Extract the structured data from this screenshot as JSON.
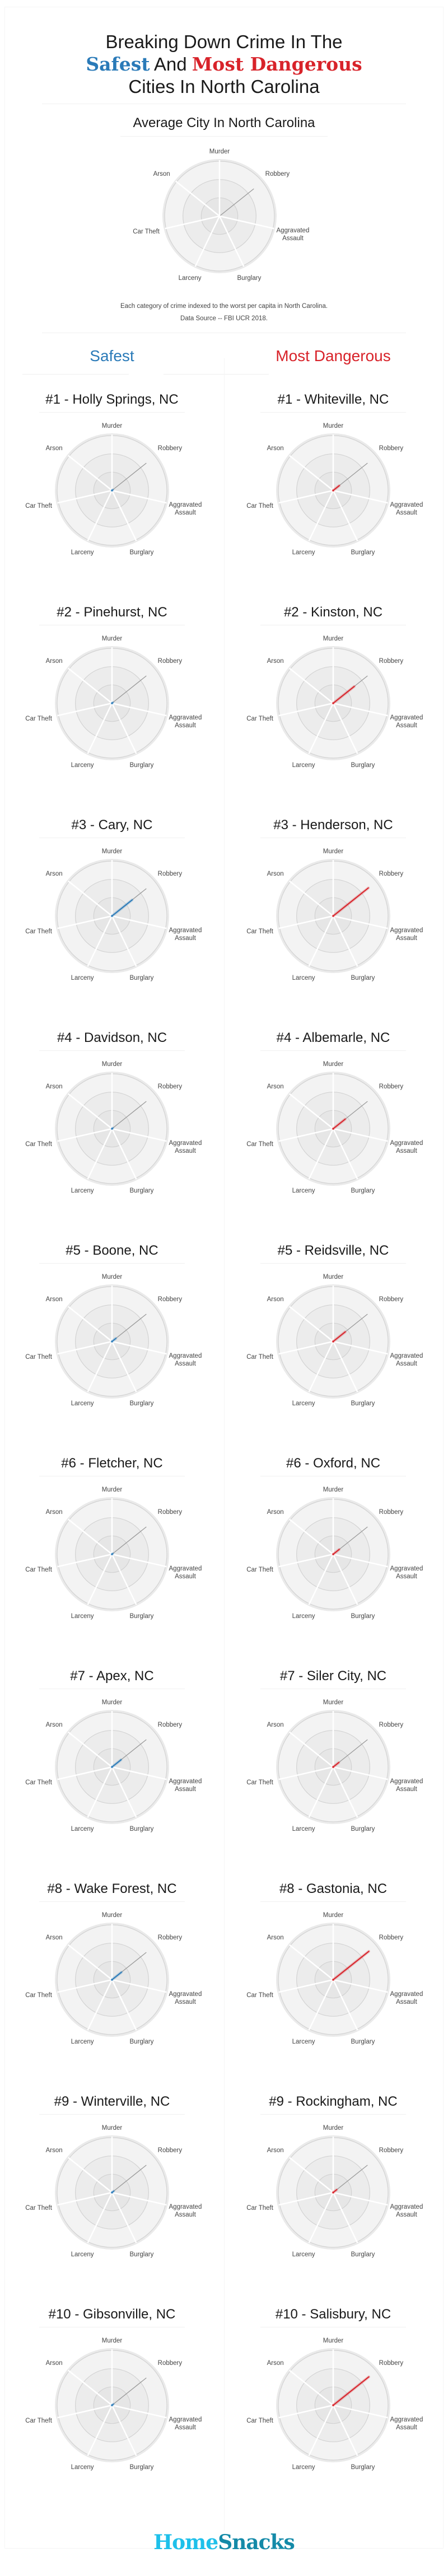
{
  "header": {
    "line1": "Breaking Down Crime In The",
    "safest": "Safest",
    "and": " And ",
    "most_dangerous": "Most Dangerous",
    "line3": "Cities In North Carolina"
  },
  "average": {
    "title": "Average City In North Carolina",
    "note_line1": "Each category of crime indexed to the worst per capita in North Carolina.",
    "note_line2": "Data Source -- FBI UCR 2018."
  },
  "columns": {
    "safest_label": "Safest",
    "dangerous_label": "Most Dangerous"
  },
  "colors": {
    "safest": "#2a7ab8",
    "dangerous": "#d8232a",
    "reference": "#9a9a9a"
  },
  "footer": {
    "logo_home": "Home",
    "logo_snacks": "Snacks"
  },
  "chart_data": {
    "type": "radar",
    "axes": [
      "Murder",
      "Robbery",
      "Aggravated Assault",
      "Burglary",
      "Larceny",
      "Car Theft",
      "Arson"
    ],
    "axis_labels": [
      [
        "Murder"
      ],
      [
        "Robbery"
      ],
      [
        "Aggravated",
        "Assault"
      ],
      [
        "Burglary"
      ],
      [
        "Larceny"
      ],
      [
        "Car Theft"
      ],
      [
        "Arson"
      ]
    ],
    "scale": "fraction of worst per capita in North Carolina",
    "rlim": [
      0,
      1
    ],
    "rings": 3,
    "average": {
      "name": "Average City In North Carolina",
      "values": [
        0,
        0.8,
        0,
        0,
        0,
        0,
        0
      ]
    },
    "safest": [
      {
        "rank": "#1",
        "city": "Holly Springs, NC",
        "values": [
          0,
          0.02,
          0,
          0,
          0,
          0,
          0
        ]
      },
      {
        "rank": "#2",
        "city": "Pinehurst, NC",
        "values": [
          0,
          0.02,
          0,
          0,
          0,
          0,
          0
        ]
      },
      {
        "rank": "#3",
        "city": "Cary, NC",
        "values": [
          0,
          0.47,
          0,
          0,
          0,
          0,
          0
        ]
      },
      {
        "rank": "#4",
        "city": "Davidson, NC",
        "values": [
          0,
          0.02,
          0,
          0,
          0,
          0,
          0
        ]
      },
      {
        "rank": "#5",
        "city": "Boone, NC",
        "values": [
          0,
          0.09,
          0,
          0,
          0,
          0,
          0
        ]
      },
      {
        "rank": "#6",
        "city": "Fletcher, NC",
        "values": [
          0,
          0.02,
          0,
          0,
          0,
          0,
          0
        ]
      },
      {
        "rank": "#7",
        "city": "Apex, NC",
        "values": [
          0,
          0.21,
          0,
          0,
          0,
          0,
          0
        ]
      },
      {
        "rank": "#8",
        "city": "Wake Forest, NC",
        "values": [
          0,
          0.22,
          0,
          0,
          0,
          0,
          0
        ]
      },
      {
        "rank": "#9",
        "city": "Winterville, NC",
        "values": [
          0,
          0.04,
          0,
          0,
          0,
          0,
          0
        ]
      },
      {
        "rank": "#10",
        "city": "Gibsonville, NC",
        "values": [
          0,
          0.03,
          0,
          0,
          0,
          0,
          0
        ]
      }
    ],
    "dangerous": [
      {
        "rank": "#1",
        "city": "Whiteville, NC",
        "values": [
          0,
          0.14,
          0,
          0,
          0,
          0,
          0
        ]
      },
      {
        "rank": "#2",
        "city": "Kinston, NC",
        "values": [
          0,
          0.49,
          0,
          0,
          0,
          0,
          0
        ]
      },
      {
        "rank": "#3",
        "city": "Henderson, NC",
        "values": [
          0,
          0.82,
          0,
          0,
          0,
          0,
          0
        ]
      },
      {
        "rank": "#4",
        "city": "Albemarle, NC",
        "values": [
          0,
          0.28,
          0,
          0,
          0,
          0,
          0
        ]
      },
      {
        "rank": "#5",
        "city": "Reidsville, NC",
        "values": [
          0,
          0.28,
          0,
          0,
          0,
          0,
          0
        ]
      },
      {
        "rank": "#6",
        "city": "Oxford, NC",
        "values": [
          0,
          0.14,
          0,
          0,
          0,
          0,
          0
        ]
      },
      {
        "rank": "#7",
        "city": "Siler City, NC",
        "values": [
          0,
          0.13,
          0,
          0,
          0,
          0,
          0
        ]
      },
      {
        "rank": "#8",
        "city": "Gastonia, NC",
        "values": [
          0,
          0.83,
          0,
          0,
          0,
          0,
          0
        ]
      },
      {
        "rank": "#9",
        "city": "Rockingham, NC",
        "values": [
          0,
          0.08,
          0,
          0,
          0,
          0,
          0
        ]
      },
      {
        "rank": "#10",
        "city": "Salisbury, NC",
        "values": [
          0,
          0.83,
          0,
          0,
          0,
          0,
          0
        ]
      }
    ]
  }
}
